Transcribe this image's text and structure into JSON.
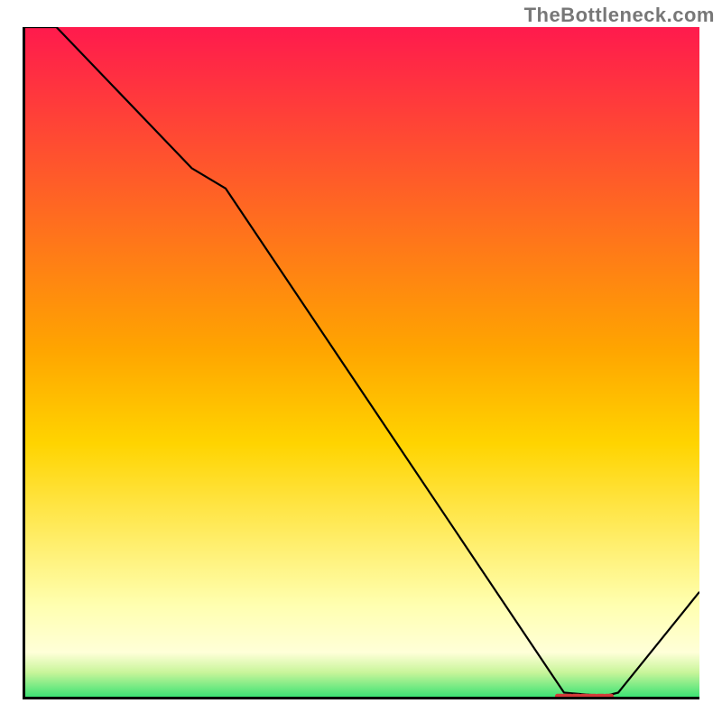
{
  "watermark": "TheBottleneck.com",
  "chart_data": {
    "type": "line",
    "title": "",
    "xlabel": "",
    "ylabel": "",
    "xlim": [
      0,
      100
    ],
    "ylim": [
      0,
      100
    ],
    "x": [
      0,
      5,
      25,
      30,
      78,
      80,
      86,
      88,
      100
    ],
    "values": [
      100,
      100,
      79,
      76,
      4,
      1,
      0.5,
      1,
      16
    ],
    "marker": {
      "x_start": 79,
      "x_end": 87,
      "y": 0.5,
      "label": ""
    },
    "colors": {
      "top": "#ff1a4d",
      "mid": "#ffd400",
      "pale": "#ffffcc",
      "green": "#2ee070",
      "line": "#000000",
      "axis": "#000000",
      "marker": "#d43a3a"
    }
  }
}
